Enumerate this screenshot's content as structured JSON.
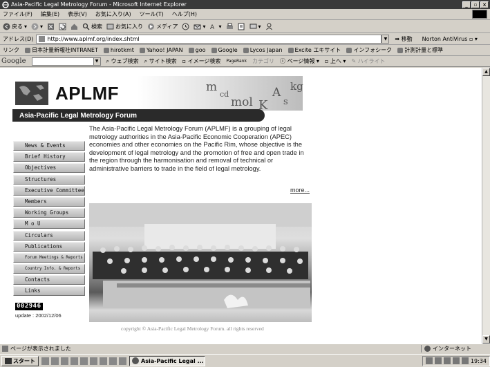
{
  "window": {
    "title": "Asia-Pacific Legal Metrology Forum - Microsoft Internet Explorer"
  },
  "menu": [
    "ファイル(F)",
    "編集(E)",
    "表示(V)",
    "お気に入り(A)",
    "ツール(T)",
    "ヘルプ(H)"
  ],
  "toolbar": {
    "back": "戻る",
    "search": "検索",
    "favorites": "お気に入り",
    "media": "メディア"
  },
  "address": {
    "label": "アドレス(D)",
    "url": "http://www.aplmf.org/index.shtml",
    "go": "移動",
    "norton": "Norton AntiVirus"
  },
  "links": {
    "label": "リンク",
    "items": [
      "日本計量新報社INTRANET",
      "hirotkmt",
      "Yahoo! JAPAN",
      "goo",
      "Google",
      "Lycos Japan",
      "Excite エキサイト",
      "インフォシーク",
      "計測計量と標準"
    ]
  },
  "googlebar": {
    "logo": "Google",
    "web_search": "ウェブ検索",
    "site_search": "サイト検索",
    "image_search": "イメージ検索",
    "pagerank_line1": "PageRank",
    "pagerank_line2": "",
    "category": "カテゴリ",
    "page_info": "ページ情報",
    "up": "上へ",
    "highlight": "ハイライト"
  },
  "page": {
    "brand": "APLMF",
    "banner_title": "Asia-Pacific Legal Metrology Forum",
    "units": [
      "m",
      "kg",
      "A",
      "cd",
      "mol",
      "s",
      "K"
    ],
    "intro": "The Asia-Pacific Legal Metrology Forum (APLMF) is a grouping of legal metrology authorities in the Asia-Pacific Economic Cooperation (APEC) economies and other economies on the Pacific Rim, whose objective is the development of legal metrology and the promotion of free and open trade in the region through the harmonisation and removal of technical or administrative barriers to trade in the field of legal metrology.",
    "more": "more...",
    "nav": [
      "News & Events",
      "Brief History",
      "Objectives",
      "Structures",
      "Executive Committee",
      "Members",
      "Working Groups",
      "M o U",
      "Circulars",
      "Publications",
      "Forum Meetings & Reports",
      "Country Info. & Reports",
      "Contacts",
      "Links"
    ],
    "counter": "002946",
    "update": "update : 2002/12/06",
    "copyright": "copyright © Asia-Pacific Legal Metrology Forum. all rights reserved"
  },
  "status": {
    "text": "ページが表示されました",
    "zone": "インターネット"
  },
  "taskbar": {
    "start": "スタート",
    "task": "Asia-Pacific Legal ...",
    "time": "19:34"
  }
}
